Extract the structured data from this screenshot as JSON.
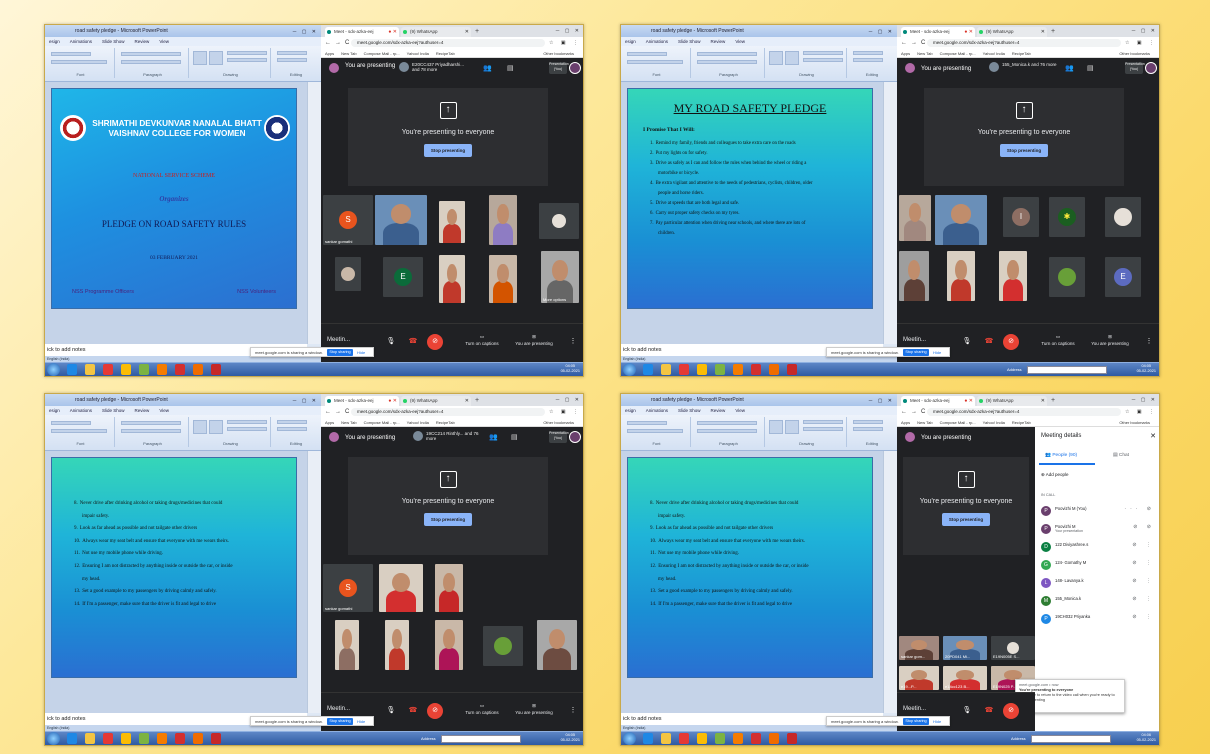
{
  "common": {
    "ppt_title": "road safety pledge - Microsoft PowerPoint",
    "ppt_menu": [
      "esign",
      "Animations",
      "Slide Show",
      "Review",
      "View"
    ],
    "ppt_groups": [
      "Font",
      "Paragraph",
      "Drawing",
      "Editing"
    ],
    "ppt_tools": [
      "Shapes",
      "Arrange",
      "Quick Styles",
      "Shape Fill",
      "Shape Outline",
      "Shape Effects",
      "Find",
      "Replace",
      "Select"
    ],
    "notes": "ick to add notes",
    "status": "English (India)",
    "tab_meet": "Meet - sdx-azka-eej",
    "tab_whatsapp": "(9) WhatsApp",
    "url": "meet.google.com/sdx-azka-eej?authuser=4",
    "bookmarks": [
      "Apps",
      "New Tab",
      "Compose Mail - rp...",
      "Yahoo! India",
      "RecipeTab"
    ],
    "other_bookmarks": "Other bookmarks",
    "you_are_presenting": "You are presenting",
    "presenting_everyone": "You're presenting to everyone",
    "stop_presenting": "Stop presenting",
    "presentation_you": "Presentation (You)",
    "meeting_details": "Meetin...",
    "turn_on_captions": "Turn on captions",
    "you_are_presenting_short": "You are presenting",
    "sharing_msg": "meet.google.com is sharing a window.",
    "stop_sharing": "Stop sharing",
    "hide": "Hide",
    "address": "Address",
    "clock_time": "04:05",
    "clock_date": "05-02-2021",
    "clock_time4": "04:06"
  },
  "shot1": {
    "pinned": "E20CC437 Priyadharshi... and 78 more",
    "college": "SHRIMATHI DEVKUNVAR NANALAL BHATT VAISHNAV COLLEGE FOR WOMEN",
    "nss": "NATIONAL SERVICE SCHEME",
    "organizes": "Organizes",
    "title": "PLEDGE ON ROAD SAFETY RULES",
    "date": "03 FEBRUARY 2021",
    "officers": "NSS Programme Officers",
    "volunteers": "NSS Volunteers",
    "tile_name": "sankar gomathi",
    "tile_letters": [
      "S",
      "E"
    ],
    "more_options": "More options"
  },
  "shot2": {
    "pinned": "155_Monica.k and 76 more",
    "heading": "MY ROAD SAFETY PLEDGE",
    "intro": "I Promise That I Will:",
    "items": [
      {
        "n": "1.",
        "t": "Remind my family, friends and colleagues to take extra care on the roads",
        "c": ""
      },
      {
        "n": "2.",
        "t": "Put my lights on for safety.",
        "c": ""
      },
      {
        "n": "3.",
        "t": "Drive as safely as I can and follow the rules when behind the wheel or riding a",
        "c": "motorbike or bicycle."
      },
      {
        "n": "4.",
        "t": "Be extra vigilant and attentive to the needs of pedestrians, cyclists, children, older",
        "c": "people and horse riders."
      },
      {
        "n": "5.",
        "t": "Drive at speeds that are both legal and safe.",
        "c": ""
      },
      {
        "n": "6.",
        "t": "Carry out proper safety checks on my tyres.",
        "c": ""
      },
      {
        "n": "7.",
        "t": "Pay particular attention when driving near schools, and where there are lots of",
        "c": "children."
      }
    ],
    "tile_letters": [
      "I",
      "E"
    ]
  },
  "shot3": {
    "pinned": "19CC214 Rinthly... and 76 more",
    "tile_name": "sankar gomathi",
    "tile_letters": [
      "S"
    ]
  },
  "pledge_b": [
    {
      "n": "8.",
      "t": "Never drive after drinking alcohol or taking drugs/medicines that could",
      "c": "impair safety."
    },
    {
      "n": "9.",
      "t": "Look as far ahead as possible and not tailgate other drivers",
      "c": ""
    },
    {
      "n": "10.",
      "t": "Always wear my seat belt and ensure that everyone with me wears theirs.",
      "c": ""
    },
    {
      "n": "11.",
      "t": "Not use my mobile phone while driving.",
      "c": ""
    },
    {
      "n": "12.",
      "t": "Ensuring I am not distracted by anything inside or outside the car, or inside",
      "c": "my head."
    },
    {
      "n": "13.",
      "t": "Set a good example to my passengers by driving calmly and safely.",
      "c": ""
    },
    {
      "n": "14.",
      "t": "If I'm a passenger, make sure that the driver is fit and legal to drive",
      "c": ""
    }
  ],
  "shot4": {
    "panel_title": "Meeting details",
    "tab_people": "People (90)",
    "tab_chat": "Chat",
    "add_people": "Add people",
    "in_call": "IN CALL",
    "people": [
      {
        "name": "Poovizhi M (You)",
        "sub": "",
        "letter": "P",
        "color": "#6a3f6d"
      },
      {
        "name": "Poovizhi M",
        "sub": "Your presentation",
        "letter": "P",
        "color": "#6a3f6d"
      },
      {
        "name": "122 Diviyashree.s",
        "sub": "",
        "letter": "D",
        "color": "#0b8043"
      },
      {
        "name": "124- Gomathy M",
        "sub": "",
        "letter": "G",
        "color": "#33a852"
      },
      {
        "name": "148- Lavanya.k",
        "sub": "",
        "letter": "L",
        "color": "#7e57c2"
      },
      {
        "name": "155_Monica.k",
        "sub": "",
        "letter": "M",
        "color": "#2e7d32"
      },
      {
        "name": "19CH032 Priyanka",
        "sub": "",
        "letter": "P",
        "color": "#1e88e5"
      }
    ],
    "tile_names": [
      "sankar gom...",
      "20PD041 Mi...",
      "E19N005E S...",
      "e19...P...",
      "e14cc123 B...",
      "E19N025 P..."
    ],
    "toast_src": "meet.google.com • now",
    "toast_line1": "You're presenting to everyone",
    "toast_line2": "Click here to return to the video call when you're ready to stop presenting"
  },
  "colors": {
    "meet_bg": "#202124",
    "stop_btn": "#8ab4f8",
    "end_call": "#ea4335",
    "slide_teal": "#35d6b8",
    "slide_blue": "#1a8fd4"
  }
}
